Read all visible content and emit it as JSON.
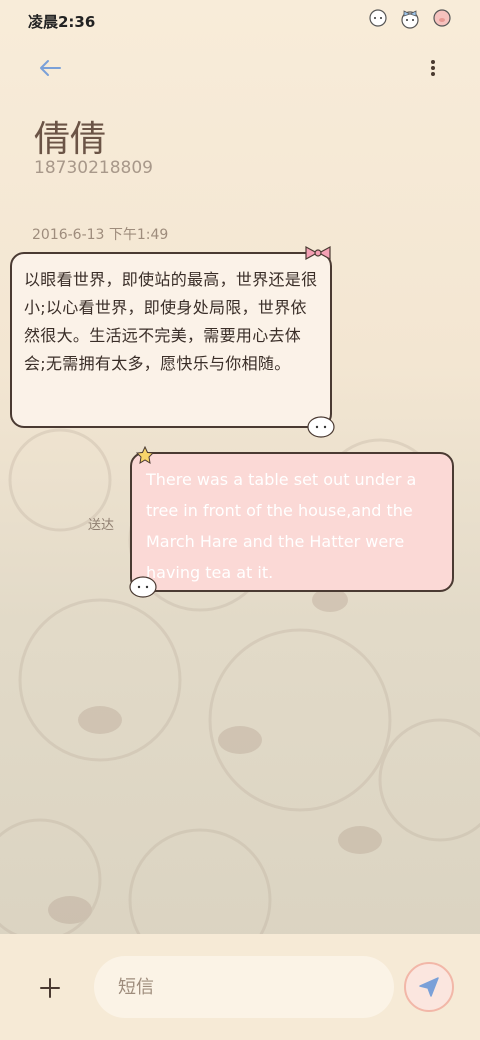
{
  "status_bar": {
    "time": "凌晨2:36",
    "icons": [
      "sheep-sticker-icon",
      "sheep-bow-sticker-icon",
      "pig-sticker-icon"
    ]
  },
  "header": {
    "back_icon": "back-arrow-icon",
    "more_icon": "more-vertical-icon",
    "contact_name": "倩倩",
    "contact_number": "18730218809"
  },
  "conversation": {
    "timestamp": "2016-6-13 下午1:49",
    "messages": [
      {
        "direction": "received",
        "text": "以眼看世界，即使站的最高，世界还是很小;以心看世界，即使身处局限，世界依然很大。生活远不完美，需要用心去体会;无需拥有太多，愿快乐与你相随。"
      },
      {
        "direction": "sent",
        "status": "送达",
        "text": "There was a table set out under a tree in front of the house,and the March Hare and the Hatter were having tea at it."
      }
    ]
  },
  "composer": {
    "add_icon": "plus-icon",
    "placeholder": "短信",
    "send_icon": "send-icon"
  },
  "colors": {
    "received_bubble": "#fbf2e8",
    "sent_bubble": "#fbd9d6",
    "accent": "#7aa0d8"
  }
}
